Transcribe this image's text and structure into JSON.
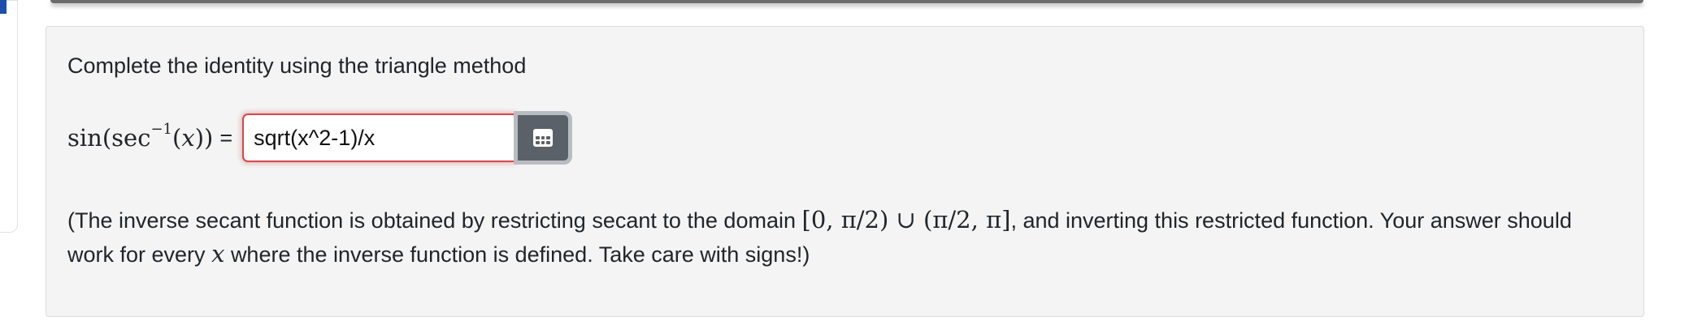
{
  "problem": {
    "prompt": "Complete the identity using the triangle method",
    "expression": {
      "func": "sin",
      "open_paren": "(",
      "inner_func": "sec",
      "exponent": "−1",
      "arg_open": "(",
      "variable": "x",
      "close_parens": "))",
      "equals": "="
    },
    "answer_input": {
      "value": "sqrt(x^2-1)/x",
      "status": "incorrect",
      "border_color": "#d14a4a"
    },
    "matrix_button": {
      "icon": "grid-icon",
      "color": "#5a6169"
    },
    "note": {
      "part1": "(The inverse secant function is obtained by restricting secant to the domain",
      "domain": "[0, π/2) ∪ (π/2, π]",
      "part2": ", and inverting this restricted function. Your answer should work for every",
      "variable": "x",
      "part3": "where the inverse function is defined. Take care with signs!)"
    }
  },
  "colors": {
    "accent_marker": "#1f4fa8",
    "card_background": "#f4f4f4"
  }
}
